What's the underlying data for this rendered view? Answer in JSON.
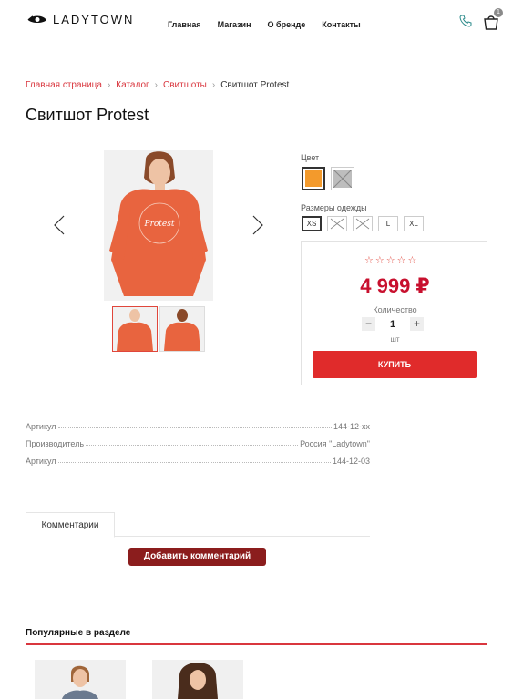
{
  "header": {
    "logo_text": "LADYTOWN",
    "nav": [
      "Главная",
      "Магазин",
      "О бренде",
      "Контакты"
    ],
    "cart_count": "1"
  },
  "breadcrumb": {
    "items": [
      "Главная страница",
      "Каталог",
      "Свитшоты"
    ],
    "current": "Свитшот Protest"
  },
  "product": {
    "title": "Свитшот Protest",
    "color_label": "Цвет",
    "colors": [
      {
        "hex": "#f39a2c",
        "state": "selected"
      },
      {
        "hex": "#bdbdbd",
        "state": "unavailable"
      }
    ],
    "size_label": "Размеры одежды",
    "sizes": [
      {
        "label": "XS",
        "state": "selected"
      },
      {
        "label": "",
        "state": "unavailable"
      },
      {
        "label": "",
        "state": "unavailable"
      },
      {
        "label": "L",
        "state": "available"
      },
      {
        "label": "XL",
        "state": "available"
      }
    ],
    "rating_stars": 0,
    "price": "4 999 ₽",
    "quantity_label": "Количество",
    "quantity": "1",
    "unit": "шт",
    "buy_label": "КУПИТЬ"
  },
  "specs": [
    {
      "name": "Артикул",
      "value": "144-12-xx"
    },
    {
      "name": "Производитель",
      "value": "Россия \"Ladytown\""
    },
    {
      "name": "Артикул",
      "value": "144-12-03"
    }
  ],
  "tabs": {
    "comments": "Комментарии",
    "add_comment": "Добавить комментарий"
  },
  "popular": {
    "title": "Популярные в разделе"
  },
  "colors": {
    "accent": "#d9363e",
    "price": "#c8102e",
    "buy_button": "#e02b2b",
    "comment_button": "#8b1d1d",
    "sweater": "#e8643f"
  }
}
